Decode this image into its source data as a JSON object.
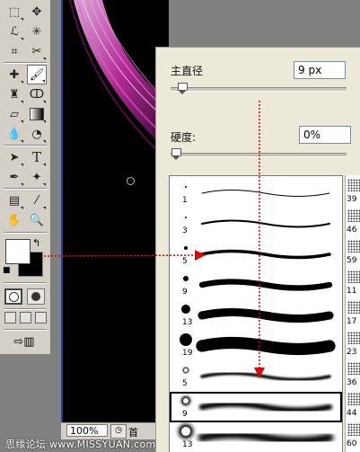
{
  "brush_panel": {
    "diameter_label": "主直径",
    "diameter_value": "9 px",
    "diameter_level": 0.04,
    "hardness_label": "硬度:",
    "hardness_value": "0%",
    "hardness_level": 0.0
  },
  "brush_presets": [
    {
      "size": "1",
      "soft": false,
      "selected": false
    },
    {
      "size": "3",
      "soft": false,
      "selected": false
    },
    {
      "size": "5",
      "soft": false,
      "selected": false
    },
    {
      "size": "9",
      "soft": false,
      "selected": false
    },
    {
      "size": "13",
      "soft": false,
      "selected": false
    },
    {
      "size": "19",
      "soft": false,
      "selected": false
    },
    {
      "size": "5",
      "soft": true,
      "selected": false
    },
    {
      "size": "9",
      "soft": true,
      "selected": true
    },
    {
      "size": "13",
      "soft": true,
      "selected": false
    }
  ],
  "brush_side_numbers": [
    "39",
    "46",
    "59",
    "11",
    "17",
    "23",
    "36",
    "44",
    "60"
  ],
  "statusbar": {
    "zoom": "100%",
    "text": "首"
  },
  "watermark": "思缘论坛 www.MISSYUAN.com",
  "colors": {
    "foreground": "#ffffff",
    "background": "#000000",
    "annotation_arrow": "#e00000",
    "canvas_glow": "#d23fb4"
  }
}
